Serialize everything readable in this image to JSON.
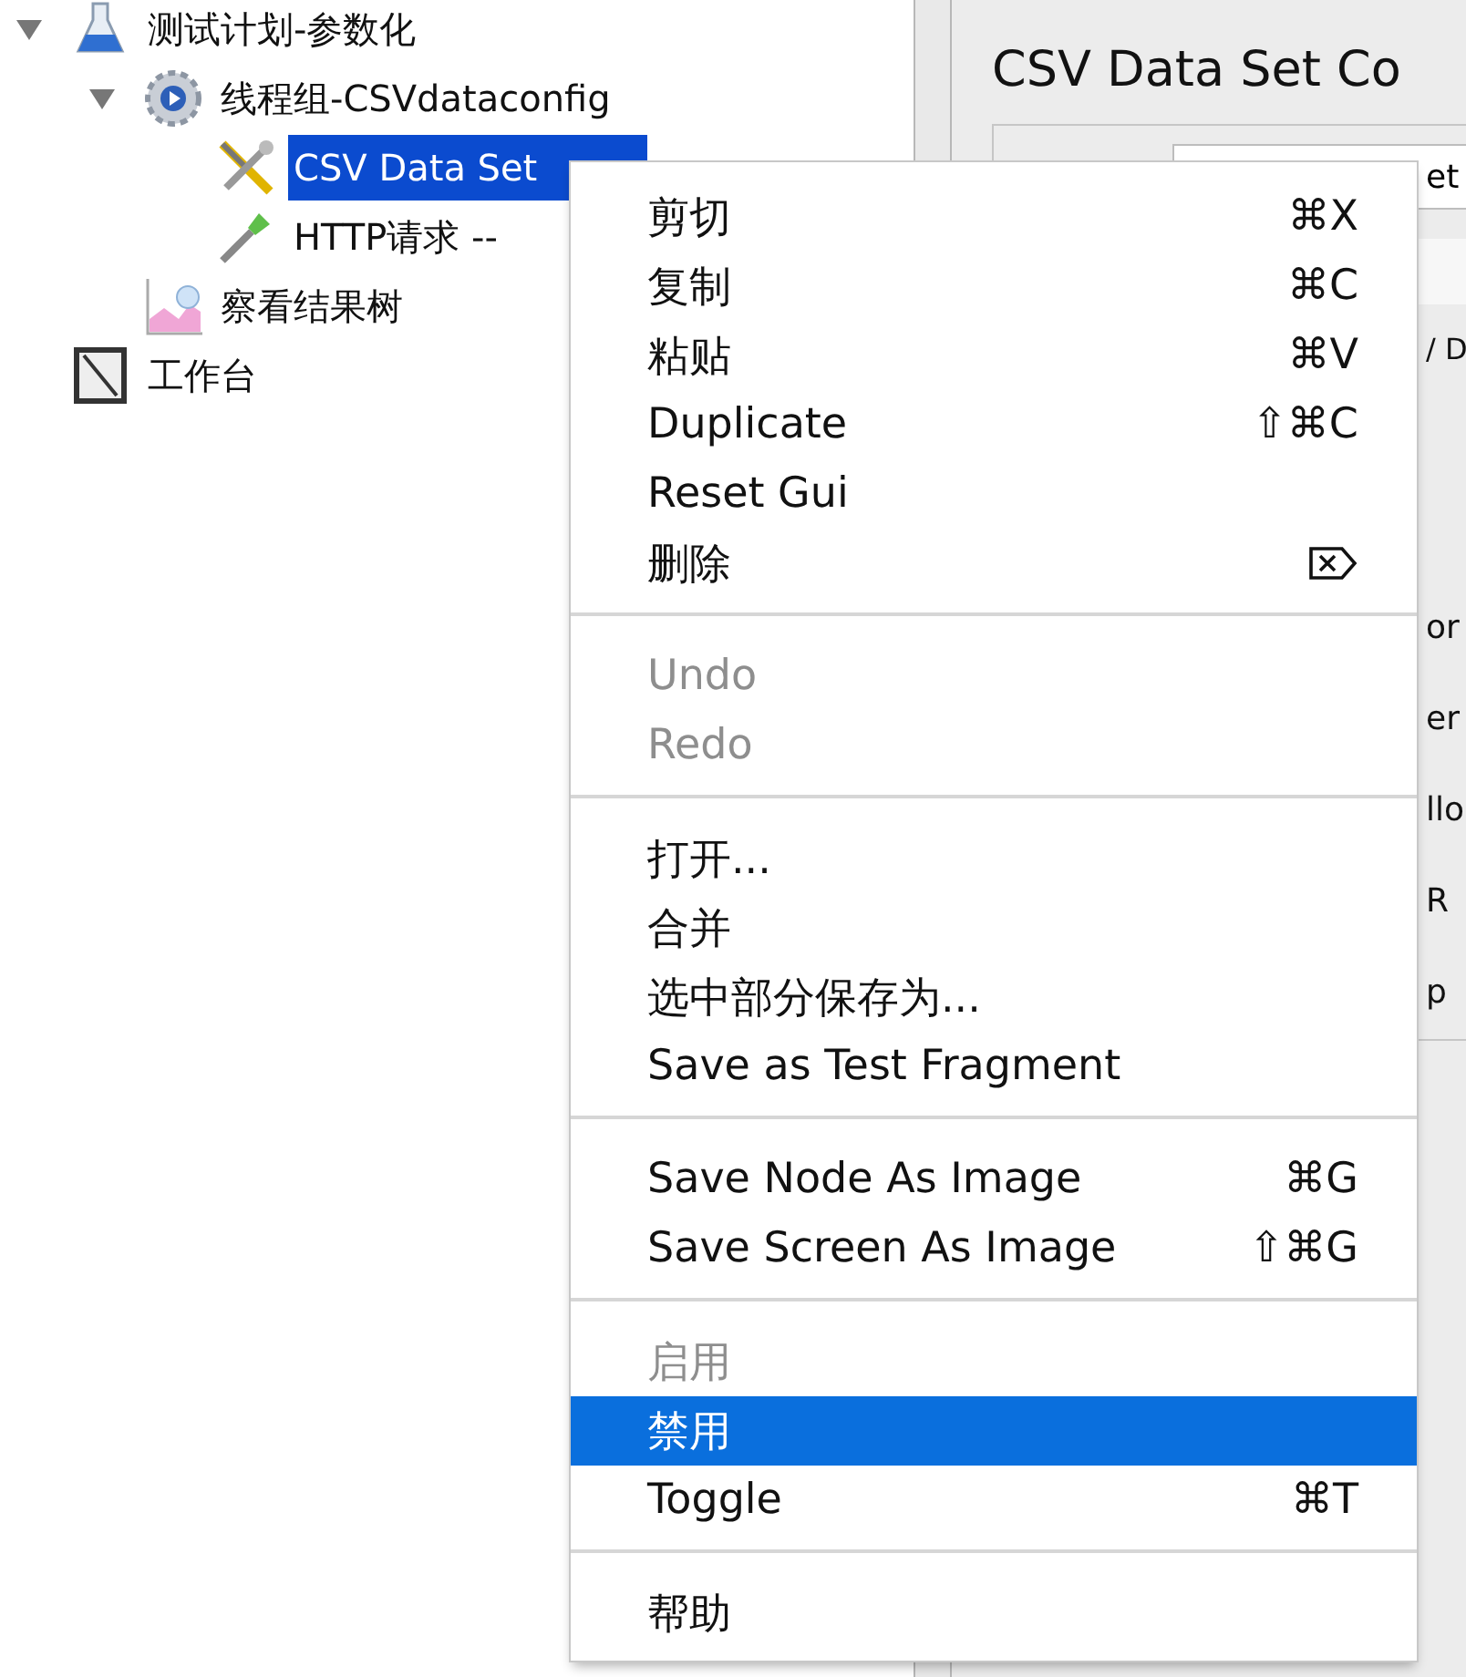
{
  "tree": [
    {
      "label": "测试计划-参数化",
      "kind": "flask",
      "expanded": true,
      "selected": false,
      "children": [
        {
          "label": "线程组-CSVdataconfig",
          "kind": "gear",
          "expanded": true,
          "selected": false,
          "children": [
            {
              "label": "CSV Data Set",
              "kind": "tools",
              "selected": true
            },
            {
              "label": "HTTP请求 --",
              "kind": "dropper",
              "selected": false
            }
          ]
        },
        {
          "label": "察看结果树",
          "kind": "chart",
          "selected": false
        }
      ]
    },
    {
      "label": "工作台",
      "kind": "notebook",
      "selected": false
    }
  ],
  "details": {
    "title": "CSV Data Set Co",
    "name_value": "et",
    "texts": [
      "/ D",
      "or",
      "er",
      "llo",
      "R",
      "p"
    ]
  },
  "context_menu": {
    "items": [
      {
        "kind": "item",
        "label": "剪切",
        "shortcut": "⌘X",
        "disabled": false,
        "selected": false
      },
      {
        "kind": "item",
        "label": "复制",
        "shortcut": "⌘C",
        "disabled": false,
        "selected": false
      },
      {
        "kind": "item",
        "label": "粘贴",
        "shortcut": "⌘V",
        "disabled": false,
        "selected": false
      },
      {
        "kind": "item",
        "label": "Duplicate",
        "shortcut": "⇧⌘C",
        "disabled": false,
        "selected": false
      },
      {
        "kind": "item",
        "label": "Reset Gui",
        "disabled": false,
        "selected": false
      },
      {
        "kind": "delete",
        "label": "删除",
        "disabled": false,
        "selected": false
      },
      {
        "kind": "separator"
      },
      {
        "kind": "item",
        "label": "Undo",
        "disabled": true,
        "selected": false
      },
      {
        "kind": "item",
        "label": "Redo",
        "disabled": true,
        "selected": false
      },
      {
        "kind": "separator"
      },
      {
        "kind": "item",
        "label": "打开...",
        "disabled": false,
        "selected": false
      },
      {
        "kind": "item",
        "label": "合并",
        "disabled": false,
        "selected": false
      },
      {
        "kind": "item",
        "label": "选中部分保存为...",
        "disabled": false,
        "selected": false
      },
      {
        "kind": "item",
        "label": "Save as Test Fragment",
        "disabled": false,
        "selected": false
      },
      {
        "kind": "separator"
      },
      {
        "kind": "item",
        "label": "Save Node As Image",
        "shortcut": "⌘G",
        "disabled": false,
        "selected": false
      },
      {
        "kind": "item",
        "label": "Save Screen As Image",
        "shortcut": "⇧⌘G",
        "disabled": false,
        "selected": false
      },
      {
        "kind": "separator"
      },
      {
        "kind": "item",
        "label": "启用",
        "disabled": true,
        "selected": false
      },
      {
        "kind": "item",
        "label": "禁用",
        "disabled": false,
        "selected": true
      },
      {
        "kind": "item",
        "label": "Toggle",
        "shortcut": "⌘T",
        "disabled": false,
        "selected": false
      },
      {
        "kind": "separator"
      },
      {
        "kind": "item",
        "label": "帮助",
        "disabled": false,
        "selected": false
      }
    ]
  }
}
